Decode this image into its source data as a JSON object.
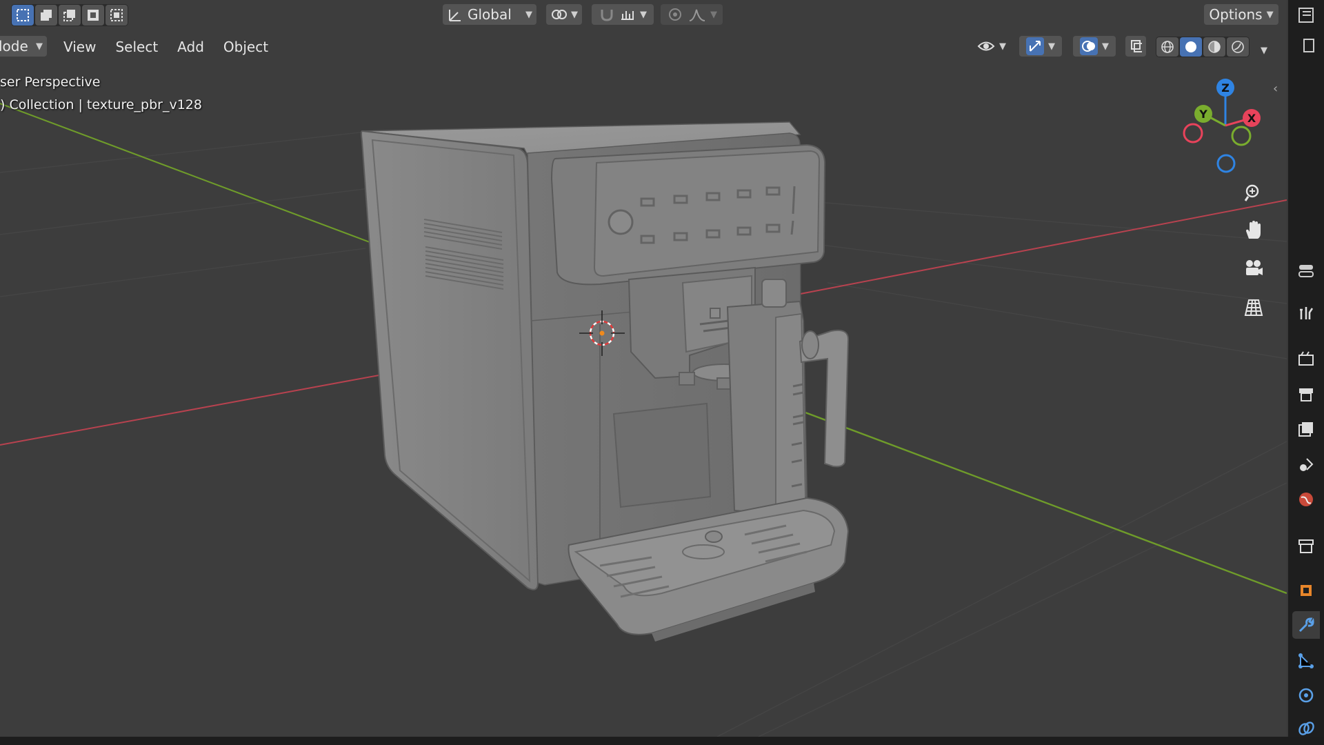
{
  "header": {
    "transform_orientation": "Global",
    "options_label": "Options",
    "mode_label": "lode"
  },
  "menu": {
    "items": [
      "View",
      "Select",
      "Add",
      "Object"
    ]
  },
  "overlay": {
    "view_name": "ser Perspective",
    "collection_info": ") Collection | texture_pbr_v128"
  },
  "gizmo": {
    "z_label": "Z",
    "y_label": "Y",
    "x_label": "X"
  },
  "colors": {
    "accent": "#4772b3",
    "axis_x": "#e8435b",
    "axis_y": "#7aad2e",
    "axis_z": "#2f84e3",
    "grid_x_line": "#b8424f",
    "grid_y_line": "#6f9c2a"
  },
  "viewport_tools": [
    "zoom-icon",
    "hand-icon",
    "camera-icon",
    "grid-icon"
  ],
  "properties_tabs": [
    "tool-icon",
    "render-icon",
    "output-icon",
    "view-layer-icon",
    "scene-icon",
    "world-icon",
    "collection-icon",
    "object-icon",
    "modifier-icon",
    "particles-icon",
    "physics-icon",
    "constraints-icon"
  ]
}
